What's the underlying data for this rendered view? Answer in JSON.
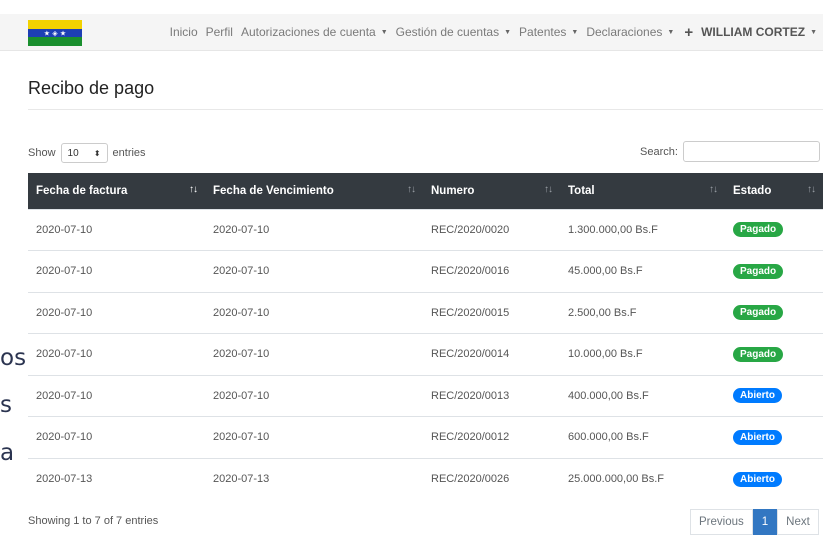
{
  "background_fragments": [
    "os",
    "s",
    "a"
  ],
  "nav": {
    "items": [
      {
        "label": "Inicio",
        "dropdown": false
      },
      {
        "label": "Perfil",
        "dropdown": false
      },
      {
        "label": "Autorizaciones de cuenta",
        "dropdown": true
      },
      {
        "label": "Gestión de cuentas",
        "dropdown": true
      },
      {
        "label": "Patentes",
        "dropdown": true
      },
      {
        "label": "Declaraciones",
        "dropdown": true
      }
    ],
    "plus_icon": "+",
    "user": "WILLIAM CORTEZ"
  },
  "page": {
    "title": "Recibo de pago"
  },
  "controls": {
    "show_label": "Show",
    "page_length": "10",
    "entries_label": "entries",
    "search_label": "Search:",
    "search_value": ""
  },
  "table": {
    "columns": [
      "Fecha de factura",
      "Fecha de Vencimiento",
      "Numero",
      "Total",
      "Estado"
    ],
    "rows": [
      {
        "fecha_factura": "2020-07-10",
        "fecha_vencimiento": "2020-07-10",
        "numero": "REC/2020/0020",
        "total": "1.300.000,00 Bs.F",
        "estado": "Pagado"
      },
      {
        "fecha_factura": "2020-07-10",
        "fecha_vencimiento": "2020-07-10",
        "numero": "REC/2020/0016",
        "total": "45.000,00 Bs.F",
        "estado": "Pagado"
      },
      {
        "fecha_factura": "2020-07-10",
        "fecha_vencimiento": "2020-07-10",
        "numero": "REC/2020/0015",
        "total": "2.500,00 Bs.F",
        "estado": "Pagado"
      },
      {
        "fecha_factura": "2020-07-10",
        "fecha_vencimiento": "2020-07-10",
        "numero": "REC/2020/0014",
        "total": "10.000,00 Bs.F",
        "estado": "Pagado"
      },
      {
        "fecha_factura": "2020-07-10",
        "fecha_vencimiento": "2020-07-10",
        "numero": "REC/2020/0013",
        "total": "400.000,00 Bs.F",
        "estado": "Abierto"
      },
      {
        "fecha_factura": "2020-07-10",
        "fecha_vencimiento": "2020-07-10",
        "numero": "REC/2020/0012",
        "total": "600.000,00 Bs.F",
        "estado": "Abierto"
      },
      {
        "fecha_factura": "2020-07-13",
        "fecha_vencimiento": "2020-07-13",
        "numero": "REC/2020/0026",
        "total": "25.000.000,00 Bs.F",
        "estado": "Abierto"
      }
    ]
  },
  "status_colors": {
    "Pagado": "#28a745",
    "Abierto": "#007bff"
  },
  "footer": {
    "info": "Showing 1 to 7 of 7 entries",
    "previous": "Previous",
    "current_page": "1",
    "next": "Next"
  }
}
